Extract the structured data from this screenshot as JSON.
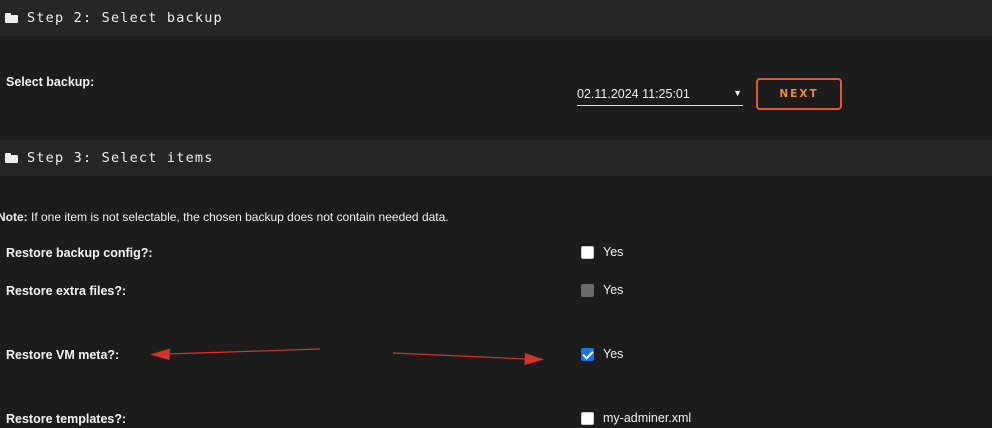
{
  "step2": {
    "title": "Step 2: Select backup",
    "select_label": "Select backup:",
    "select_value": "02.11.2024 11:25:01",
    "next_label": "NEXT"
  },
  "step3": {
    "title": "Step 3: Select items",
    "note_bold": "Note:",
    "note_text": " If one item is not selectable, the chosen backup does not contain needed data.",
    "items": [
      {
        "label": "Restore backup config?:",
        "option": "Yes",
        "state": "unchecked"
      },
      {
        "label": "Restore extra files?:",
        "option": "Yes",
        "state": "disabled"
      },
      {
        "label": "Restore VM meta?:",
        "option": "Yes",
        "state": "checked"
      },
      {
        "label": "Restore templates?:",
        "option": "my-adminer.xml",
        "state": "unchecked"
      }
    ]
  },
  "colors": {
    "accent": "#e8582f",
    "arrow": "#d9302a",
    "checkbox_checked": "#1a73e8"
  },
  "icons": {
    "section": "folder-icon",
    "dropdown": "chevron-down-icon"
  }
}
